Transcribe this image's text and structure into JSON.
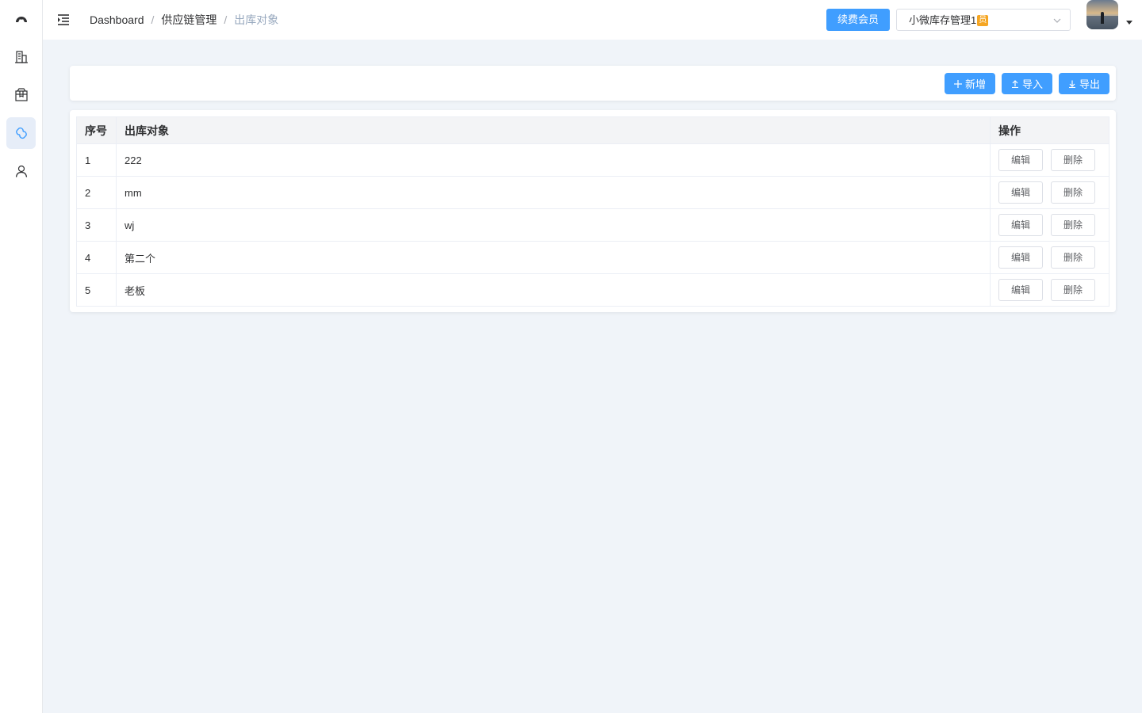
{
  "sidebar": {
    "items": [
      {
        "name": "dashboard",
        "icon": "dashboard-gauge-icon"
      },
      {
        "name": "building",
        "icon": "building-icon"
      },
      {
        "name": "package",
        "icon": "package-icon"
      },
      {
        "name": "supply-chain",
        "icon": "chain-link-icon",
        "active": true
      },
      {
        "name": "user",
        "icon": "user-icon"
      }
    ]
  },
  "header": {
    "breadcrumb": [
      "Dashboard",
      "供应链管理",
      "出库对象"
    ],
    "renew_label": "续费会员",
    "store_select": {
      "value": "小微库存管理1",
      "badge": "员"
    }
  },
  "toolbar": {
    "add_label": "新增",
    "import_label": "导入",
    "export_label": "导出"
  },
  "table": {
    "headers": {
      "index": "序号",
      "name": "出库对象",
      "ops": "操作"
    },
    "edit_label": "编辑",
    "delete_label": "删除",
    "rows": [
      {
        "index": "1",
        "name": "222"
      },
      {
        "index": "2",
        "name": "mm"
      },
      {
        "index": "3",
        "name": "wj"
      },
      {
        "index": "4",
        "name": "第二个"
      },
      {
        "index": "5",
        "name": "老板"
      }
    ]
  },
  "colors": {
    "primary": "#409eff",
    "background": "#f0f4f9",
    "active_nav": "#e6edf8",
    "badge": "#f5a623"
  }
}
